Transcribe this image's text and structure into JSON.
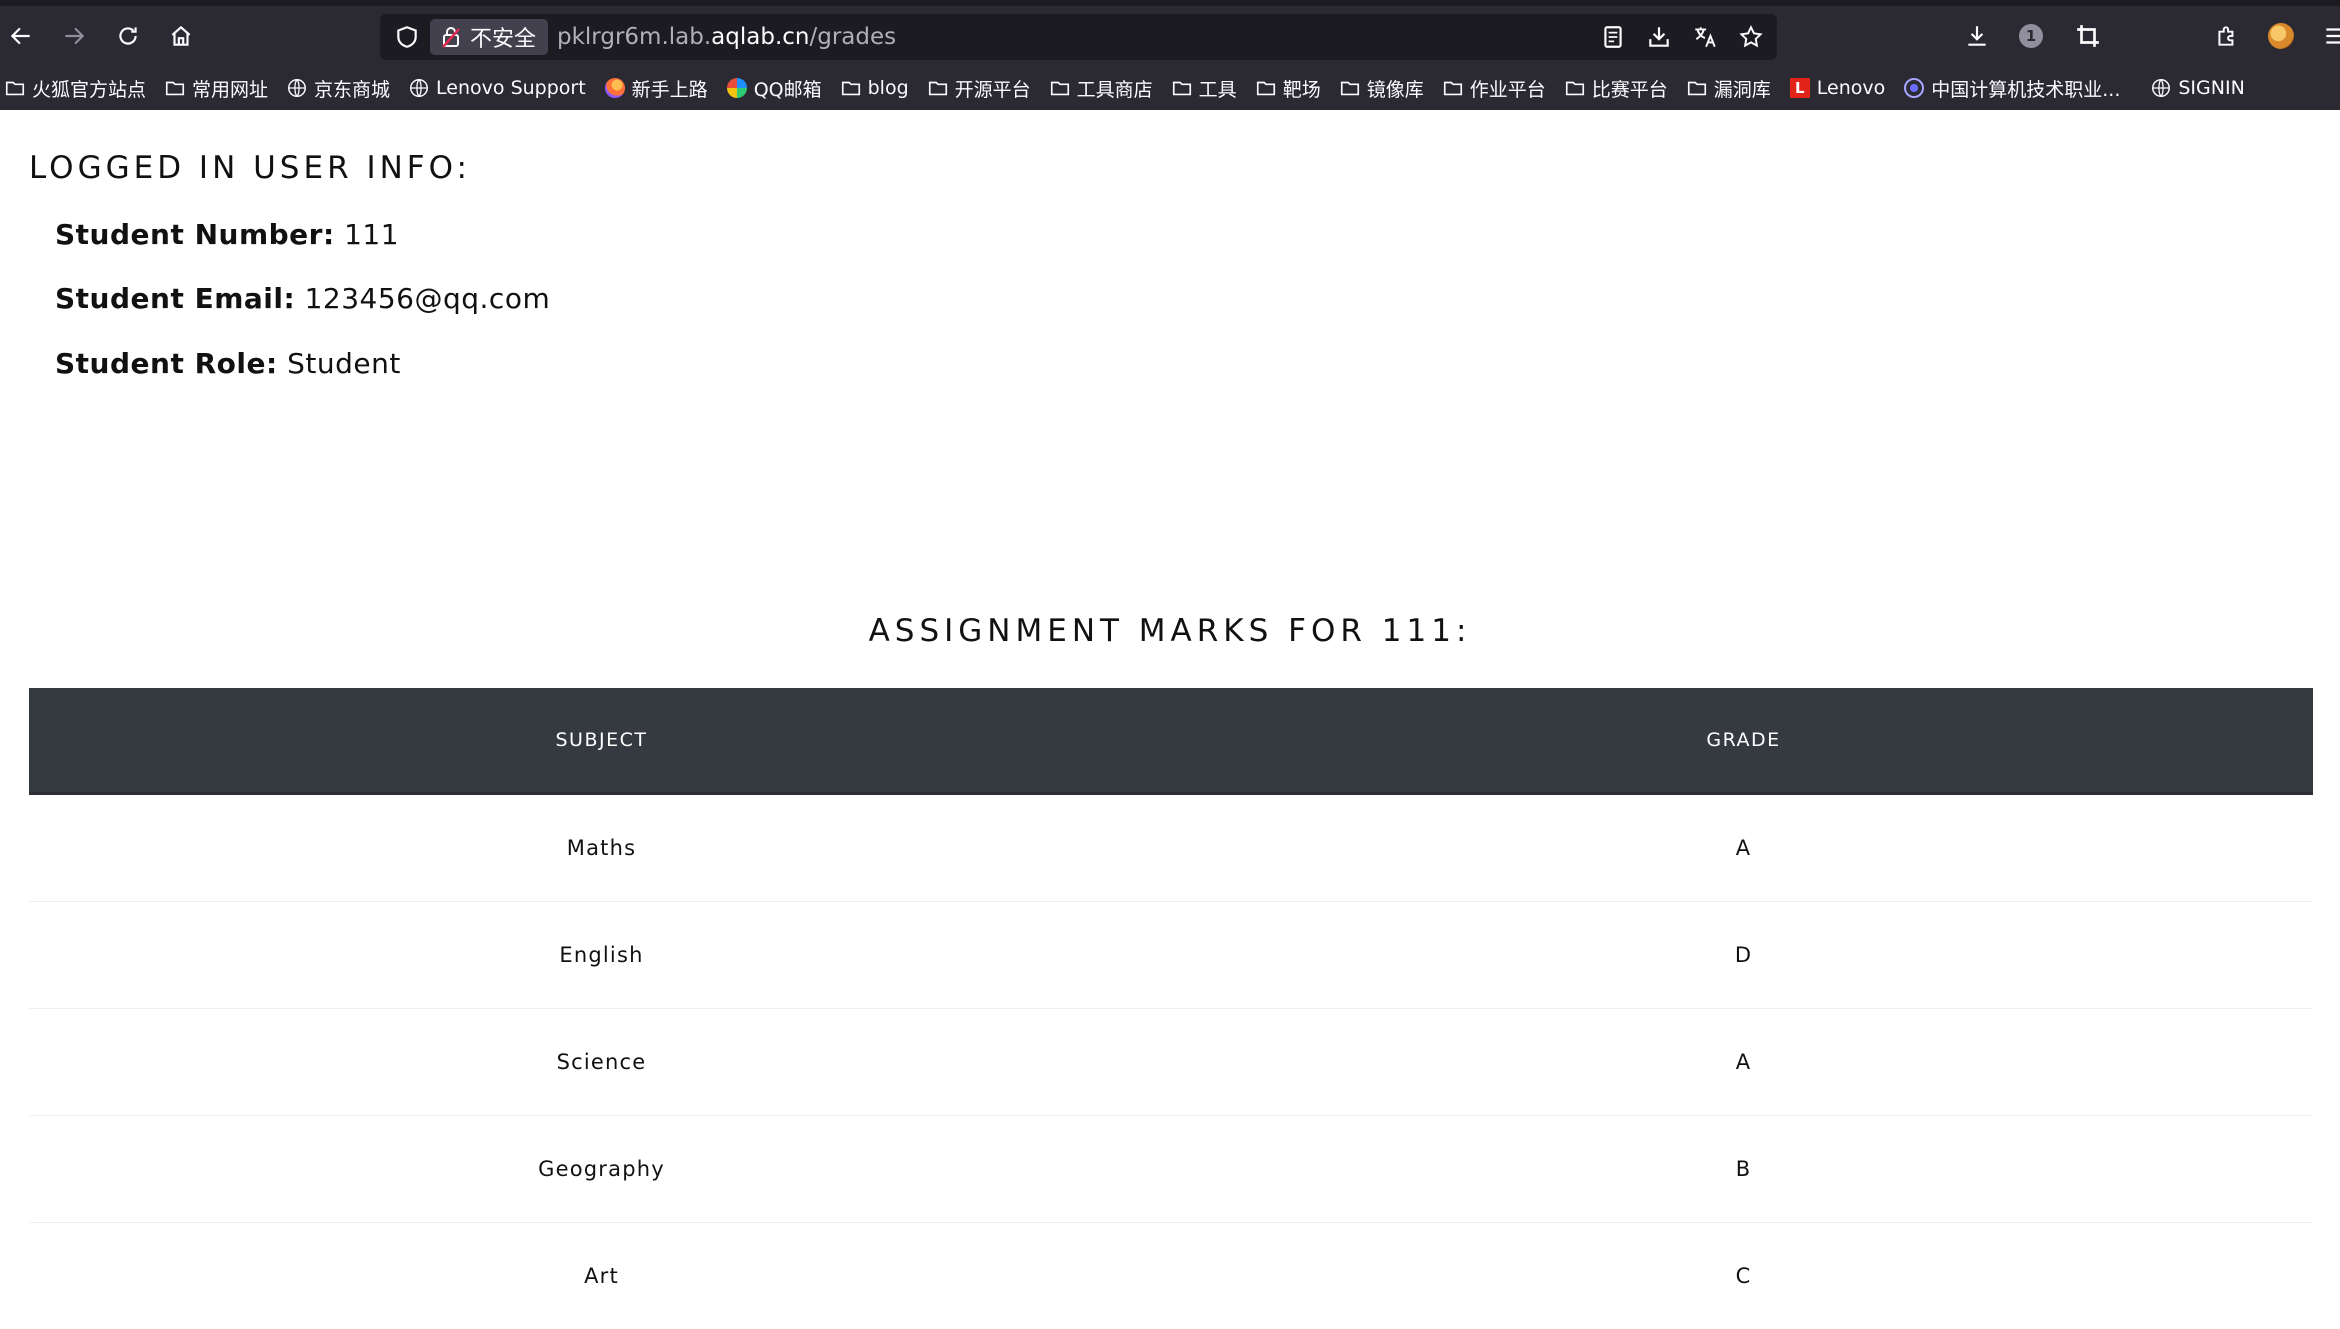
{
  "browser": {
    "insecure_label": "不安全",
    "url_prefix": "pklrgr6m.lab.",
    "url_host": "aqlab.cn",
    "url_path": "/grades",
    "downloads_count": "1",
    "bookmarks": [
      {
        "label": "火狐官方站点",
        "icon": "folder-icon"
      },
      {
        "label": "常用网址",
        "icon": "folder-icon"
      },
      {
        "label": "京东商城",
        "icon": "globe-icon"
      },
      {
        "label": "Lenovo Support",
        "icon": "globe-icon"
      },
      {
        "label": "新手上路",
        "icon": "firefox-icon"
      },
      {
        "label": "QQ邮箱",
        "icon": "qq-mail-icon"
      },
      {
        "label": "blog",
        "icon": "folder-icon"
      },
      {
        "label": "开源平台",
        "icon": "folder-icon"
      },
      {
        "label": "工具商店",
        "icon": "folder-icon"
      },
      {
        "label": "工具",
        "icon": "folder-icon"
      },
      {
        "label": "靶场",
        "icon": "folder-icon"
      },
      {
        "label": "镜像库",
        "icon": "folder-icon"
      },
      {
        "label": "作业平台",
        "icon": "folder-icon"
      },
      {
        "label": "比赛平台",
        "icon": "folder-icon"
      },
      {
        "label": "漏洞库",
        "icon": "folder-icon"
      },
      {
        "label": "Lenovo",
        "icon": "lenovo-icon"
      },
      {
        "label": "中国计算机技术职业...",
        "icon": "site-icon"
      },
      {
        "label": "SIGNIN",
        "icon": "globe-icon"
      }
    ]
  },
  "page": {
    "info_heading": "LOGGED IN USER INFO:",
    "student_number_label": "Student Number:",
    "student_number": "111",
    "student_email_label": "Student Email:",
    "student_email": "123456@qq.com",
    "student_role_label": "Student Role:",
    "student_role": "Student",
    "marks_heading": "ASSIGNMENT MARKS FOR 111:",
    "table": {
      "headers": [
        "SUBJECT",
        "GRADE"
      ],
      "rows": [
        [
          "Maths",
          "A"
        ],
        [
          "English",
          "D"
        ],
        [
          "Science",
          "A"
        ],
        [
          "Geography",
          "B"
        ],
        [
          "Art",
          "C"
        ]
      ]
    }
  }
}
